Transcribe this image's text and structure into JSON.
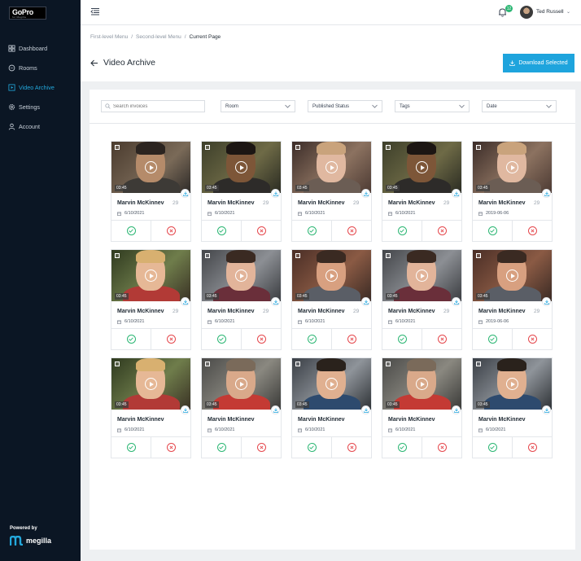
{
  "brand": {
    "logo_text": "GoPro",
    "logo_sub": "for Megilla"
  },
  "sidebar": {
    "items": [
      {
        "label": "Dashboard",
        "icon": "grid-icon",
        "active": false
      },
      {
        "label": "Rooms",
        "icon": "chat-icon",
        "active": false
      },
      {
        "label": "Video Archive",
        "icon": "video-icon",
        "active": true
      },
      {
        "label": "Settings",
        "icon": "gear-icon",
        "active": false
      },
      {
        "label": "Account",
        "icon": "user-icon",
        "active": false
      }
    ],
    "powered_by": "Powered by",
    "powered_brand": "megilla"
  },
  "topbar": {
    "notification_count": "12",
    "user_name": "Ted Russell"
  },
  "breadcrumb": {
    "level1": "First-level Menu",
    "sep": "/",
    "level2": "Second-level Menu",
    "current": "Current Page"
  },
  "page": {
    "title": "Video Archive",
    "download_label": "Download Selected"
  },
  "filters": {
    "search_placeholder": "Search invoices",
    "room": "Room",
    "status": "Published Status",
    "tags": "Tags",
    "date": "Date"
  },
  "cards": [
    {
      "name": "Marvin McKinnev",
      "age": "29",
      "date": "6/10/2021",
      "duration": "03:45"
    },
    {
      "name": "Marvin McKinnev",
      "age": "29",
      "date": "6/10/2021",
      "duration": "03:45"
    },
    {
      "name": "Marvin McKinnev",
      "age": "29",
      "date": "6/10/2021",
      "duration": "03:45"
    },
    {
      "name": "Marvin McKinnev",
      "age": "29",
      "date": "6/10/2021",
      "duration": "03:45"
    },
    {
      "name": "Marvin McKinnev",
      "age": "29",
      "date": "2019-06-06",
      "duration": "03:45"
    },
    {
      "name": "Marvin McKinnev",
      "age": "29",
      "date": "6/10/2021",
      "duration": "03:45"
    },
    {
      "name": "Marvin McKinnev",
      "age": "29",
      "date": "6/10/2021",
      "duration": "03:45"
    },
    {
      "name": "Marvin McKinnev",
      "age": "29",
      "date": "6/10/2021",
      "duration": "03:45"
    },
    {
      "name": "Marvin McKinnev",
      "age": "29",
      "date": "6/10/2021",
      "duration": "03:45"
    },
    {
      "name": "Marvin McKinnev",
      "age": "29",
      "date": "2019-06-06",
      "duration": "03:45"
    },
    {
      "name": "Marvin McKinnev",
      "age": "",
      "date": "6/10/2021",
      "duration": "03:45"
    },
    {
      "name": "Marvin McKinnev",
      "age": "",
      "date": "6/10/2021",
      "duration": "03:45"
    },
    {
      "name": "Marvin McKinnev",
      "age": "",
      "date": "6/10/2021",
      "duration": "03:45"
    },
    {
      "name": "Marvin McKinnev",
      "age": "",
      "date": "6/10/2021",
      "duration": "03:45"
    },
    {
      "name": "Marvin McKinnev",
      "age": "",
      "date": "6/10/2021",
      "duration": "03:45"
    }
  ],
  "colors": {
    "accent": "#1ea4dd",
    "sidebar": "#0b1624",
    "approve": "#2bb673",
    "reject": "#e5484d"
  }
}
